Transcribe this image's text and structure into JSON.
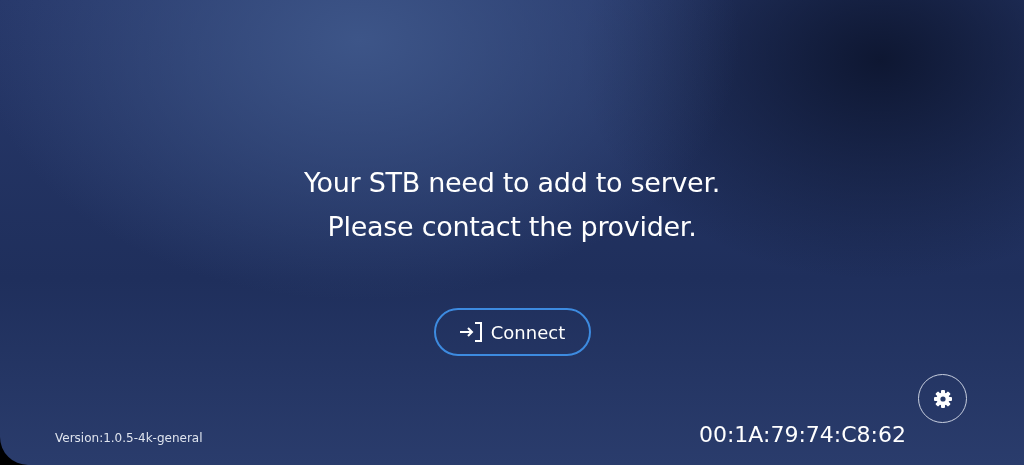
{
  "message": [
    "Your STB need to add to server.",
    "Please contact the provider."
  ],
  "connect_button": {
    "label": "Connect"
  },
  "version": "Version:1.0.5-4k-general",
  "mac_address": "00:1A:79:74:C8:62"
}
